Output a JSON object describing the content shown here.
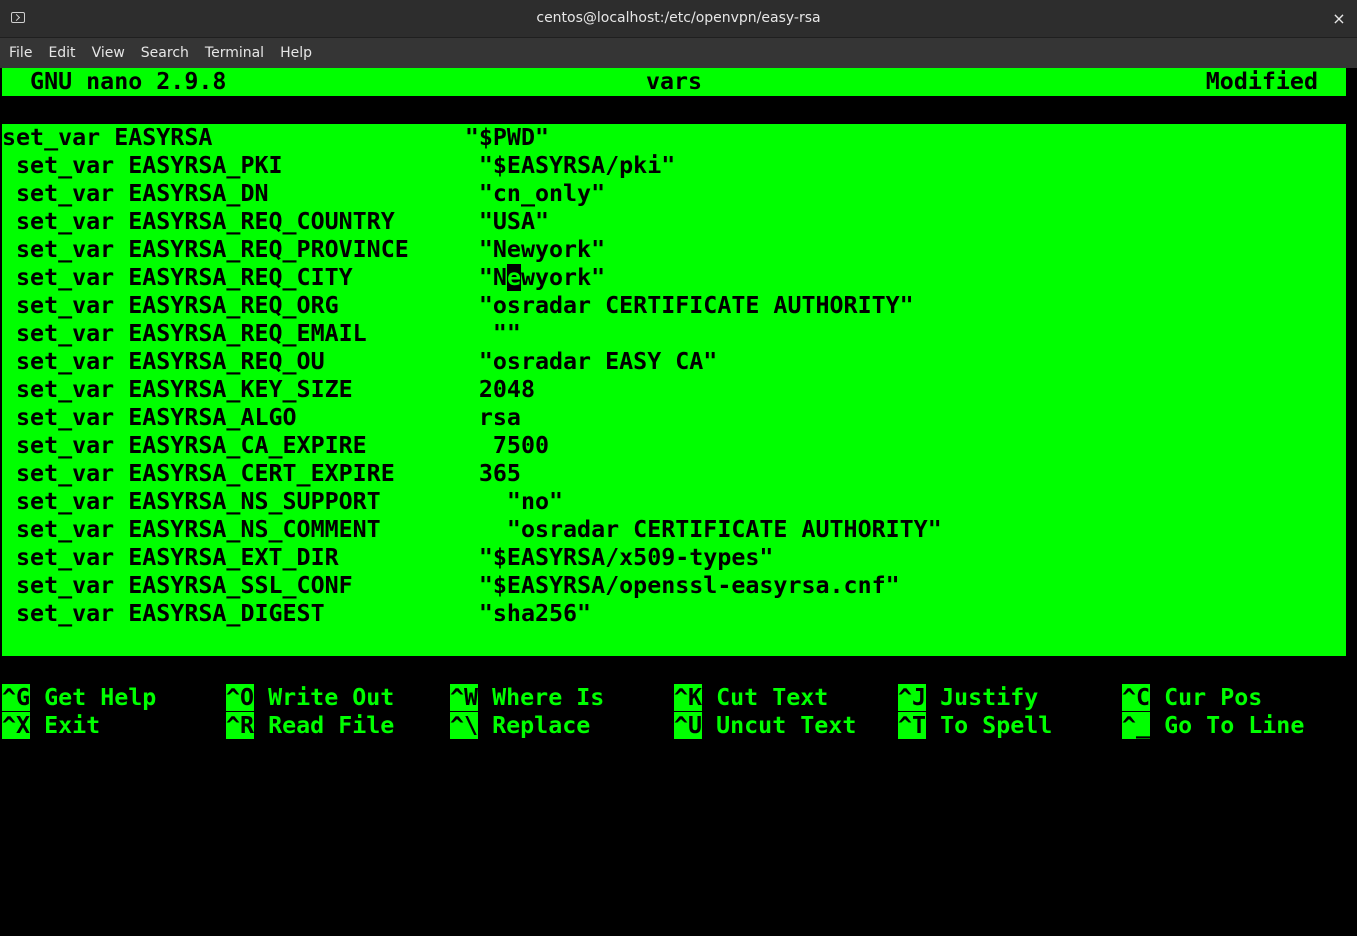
{
  "window": {
    "title": "centos@localhost:/etc/openvpn/easy-rsa",
    "close_label": "×",
    "icon": "terminal-icon"
  },
  "menu": [
    "File",
    "Edit",
    "View",
    "Search",
    "Terminal",
    "Help"
  ],
  "nano": {
    "version": "  GNU nano 2.9.8",
    "filename": "vars",
    "status": "Modified"
  },
  "lines": [
    "set_var EASYRSA                  \"$PWD\"",
    " set_var EASYRSA_PKI              \"$EASYRSA/pki\"",
    " set_var EASYRSA_DN               \"cn_only\"",
    " set_var EASYRSA_REQ_COUNTRY      \"USA\"",
    " set_var EASYRSA_REQ_PROVINCE     \"Newyork\"",
    " set_var EASYRSA_REQ_CITY         \"Newyork\"",
    " set_var EASYRSA_REQ_ORG          \"osradar CERTIFICATE AUTHORITY\"",
    " set_var EASYRSA_REQ_EMAIL         \"\"",
    " set_var EASYRSA_REQ_OU           \"osradar EASY CA\"",
    " set_var EASYRSA_KEY_SIZE         2048",
    " set_var EASYRSA_ALGO             rsa",
    " set_var EASYRSA_CA_EXPIRE         7500",
    " set_var EASYRSA_CERT_EXPIRE      365",
    " set_var EASYRSA_NS_SUPPORT         \"no\"",
    " set_var EASYRSA_NS_COMMENT         \"osradar CERTIFICATE AUTHORITY\"",
    " set_var EASYRSA_EXT_DIR          \"$EASYRSA/x509-types\"",
    " set_var EASYRSA_SSL_CONF         \"$EASYRSA/openssl-easyrsa.cnf\"",
    " set_var EASYRSA_DIGEST           \"sha256\""
  ],
  "cursor_line": {
    "before": " set_var EASYRSA_REQ_CITY         \"N",
    "char": "e",
    "after": "wyork\""
  },
  "shortcuts": [
    [
      {
        "key": "^G",
        "label": " Get Help"
      },
      {
        "key": "^O",
        "label": " Write Out"
      },
      {
        "key": "^W",
        "label": " Where Is"
      },
      {
        "key": "^K",
        "label": " Cut Text"
      },
      {
        "key": "^J",
        "label": " Justify"
      },
      {
        "key": "^C",
        "label": " Cur Pos"
      }
    ],
    [
      {
        "key": "^X",
        "label": " Exit"
      },
      {
        "key": "^R",
        "label": " Read File"
      },
      {
        "key": "^\\",
        "label": " Replace"
      },
      {
        "key": "^U",
        "label": " Uncut Text"
      },
      {
        "key": "^T",
        "label": " To Spell"
      },
      {
        "key": "^_",
        "label": " Go To Line"
      }
    ]
  ],
  "colors": {
    "accent": "#00ff00",
    "background": "#000000"
  }
}
